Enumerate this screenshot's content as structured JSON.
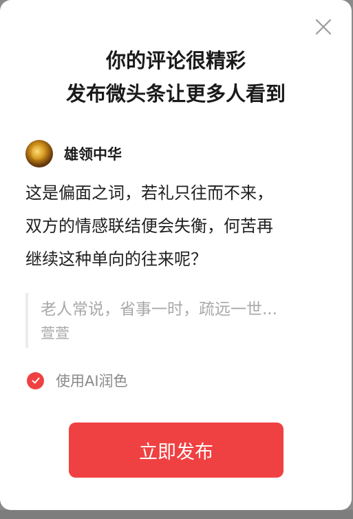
{
  "modal": {
    "title_line1": "你的评论很精彩",
    "title_line2": "发布微头条让更多人看到",
    "close_icon": "close-icon"
  },
  "author": {
    "name": "雄领中华",
    "avatar_icon": "avatar"
  },
  "comment": {
    "line1": "这是偏面之词，若礼只往而不来，",
    "line2": "双方的情感联结便会失衡，何苦再",
    "line3": "继续这种单向的往来呢？"
  },
  "quote": {
    "text": "老人常说，省事一时，疏远一世...",
    "author": "萱萱"
  },
  "ai_option": {
    "label": "使用AI润色",
    "checked": true,
    "accent_color": "#f04142"
  },
  "publish": {
    "label": "立即发布",
    "color": "#f04142"
  }
}
